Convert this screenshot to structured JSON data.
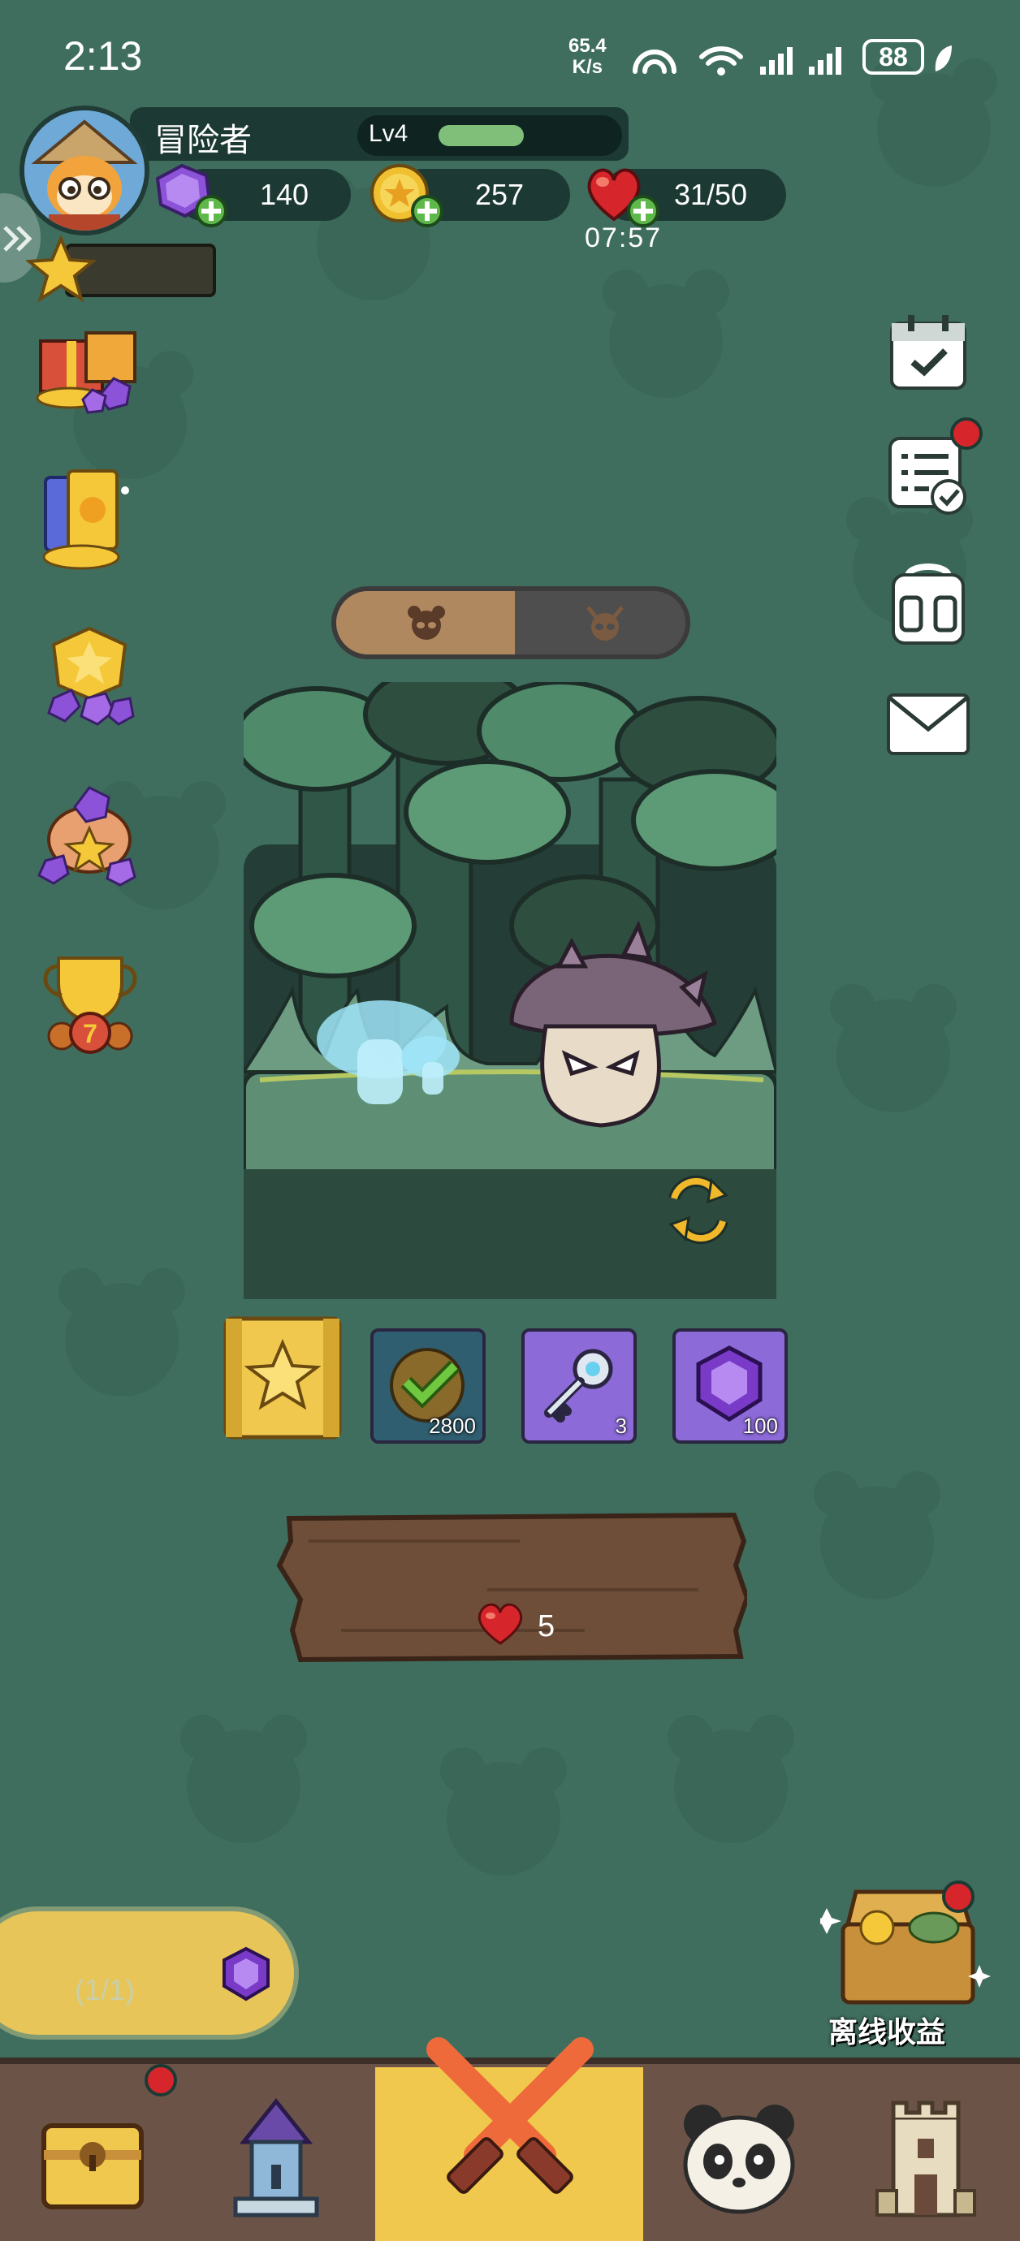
{
  "status_bar": {
    "time": "2:13",
    "net_speed_value": "65.4",
    "net_speed_unit": "K/s",
    "battery": "88"
  },
  "player": {
    "name": "冒险者",
    "level_label": "Lv4",
    "level_progress": 0.35
  },
  "resources": {
    "gems": "140",
    "coins": "257",
    "hearts": "31/50",
    "heart_timer": "07:57"
  },
  "stage": {
    "rewards": [
      {
        "icon": "star-chest-icon",
        "amount": ""
      },
      {
        "icon": "checkmark-coin-icon",
        "amount": "2800"
      },
      {
        "icon": "key-icon",
        "amount": "3"
      },
      {
        "icon": "gem-icon",
        "amount": "100"
      }
    ],
    "challenge_cost": "5"
  },
  "quest": {
    "progress": "(1/1)"
  },
  "offline_rewards": {
    "label": "离线收益"
  },
  "nav": {
    "items": [
      "chest-tab",
      "tower-tab",
      "battle-tab",
      "panda-tab",
      "castle-tab"
    ],
    "selected": "battle-tab"
  },
  "colors": {
    "background": "#3f6e5e",
    "panel": "#1c3a33",
    "accent_yellow": "#f0c84e",
    "gem_purple": "#8c52d8",
    "heart_red": "#d7262b",
    "nav_brown": "#6b5447"
  }
}
